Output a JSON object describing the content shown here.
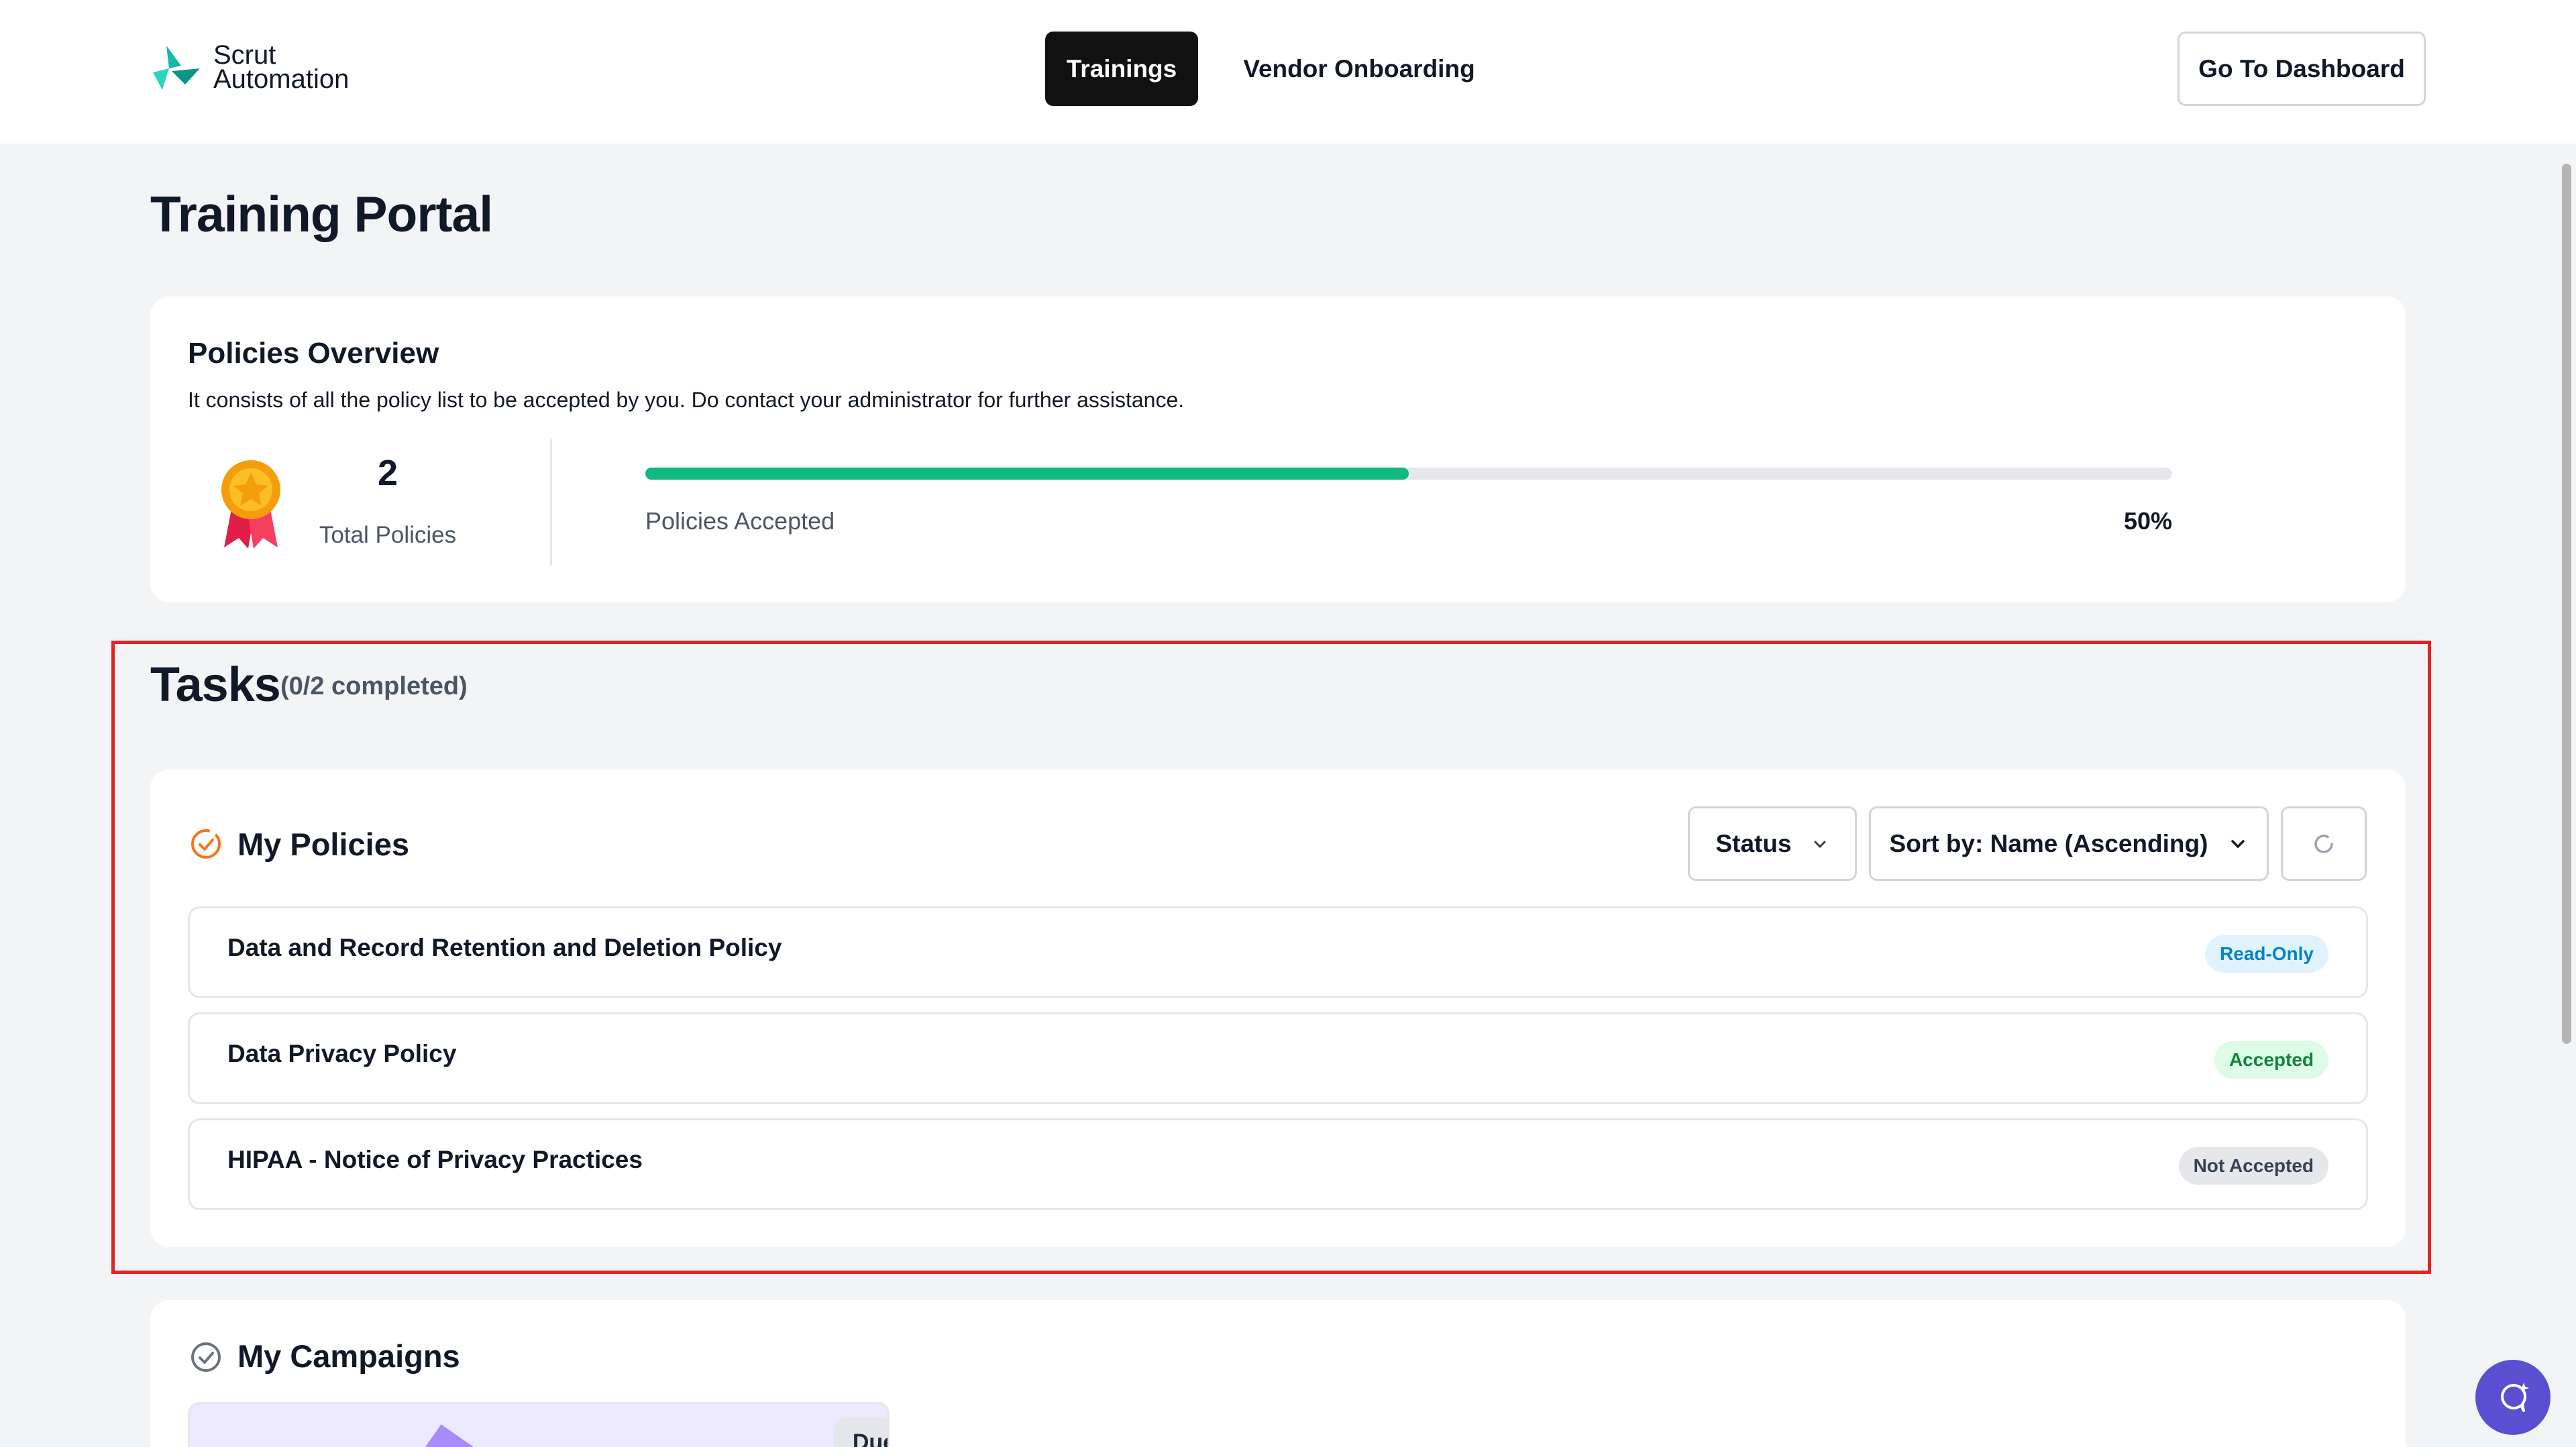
{
  "header": {
    "logo": {
      "line1": "Scrut",
      "line2": "Automation"
    },
    "nav": [
      {
        "label": "Trainings",
        "active": true
      },
      {
        "label": "Vendor Onboarding",
        "active": false
      }
    ],
    "dashboard_button": "Go To Dashboard"
  },
  "page_title": "Training Portal",
  "overview": {
    "title": "Policies Overview",
    "description": "It consists of all the policy list to be accepted by you. Do contact your administrator for further assistance.",
    "total_value": "2",
    "total_label": "Total Policies",
    "progress_label": "Policies Accepted",
    "progress_text": "50%",
    "progress_fraction": 0.5
  },
  "tasks": {
    "title": "Tasks",
    "subtitle": "(0/2 completed)"
  },
  "my_policies": {
    "title": "My Policies",
    "status_filter": "Status",
    "sort_label": "Sort by: Name (Ascending)",
    "rows": [
      {
        "name": "Data and Record Retention and Deletion Policy",
        "badge": "Read-Only"
      },
      {
        "name": "Data Privacy Policy",
        "badge": "Accepted"
      },
      {
        "name": "HIPAA - Notice of Privacy Practices",
        "badge": "Not Accepted"
      }
    ]
  },
  "my_campaigns": {
    "title": "My Campaigns",
    "card_badge": "Due"
  },
  "colors": {
    "accent": "#10b981",
    "highlight": "#e02424",
    "chat": "#5b4fd1"
  },
  "icons": [
    "logo-icon",
    "medal-icon",
    "check-circle-icon",
    "chevron-down-icon",
    "refresh-icon",
    "chat-icon"
  ]
}
